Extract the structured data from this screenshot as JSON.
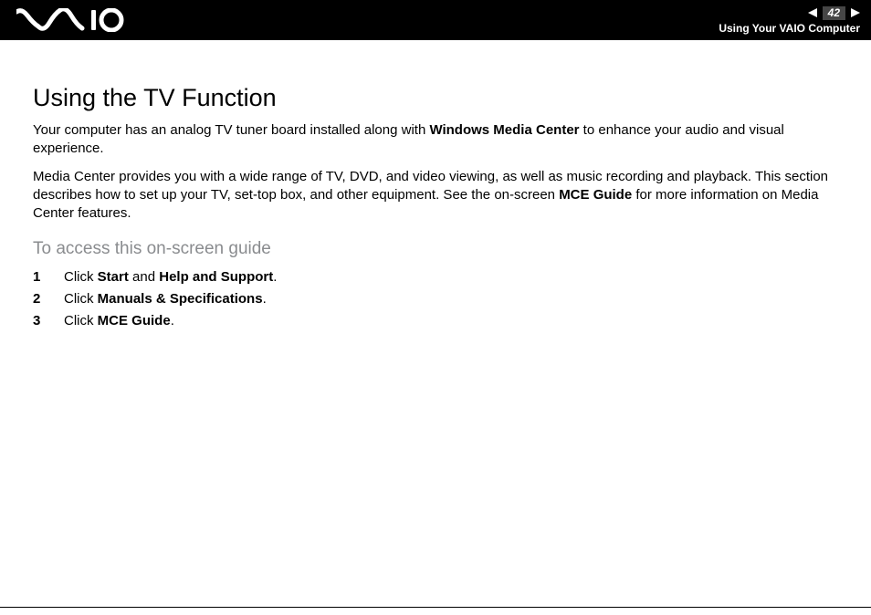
{
  "header": {
    "brand": "VAIO",
    "page_number": "42",
    "section": "Using Your VAIO Computer"
  },
  "main": {
    "title": "Using the TV Function",
    "para1": {
      "pre": "Your computer has an analog TV tuner board installed along with ",
      "bold1": "Windows Media Center",
      "post": " to enhance your audio and visual experience."
    },
    "para2": {
      "pre": "Media Center provides you with a wide range of TV, DVD, and video viewing, as well as music recording and playback. This section describes how to set up your TV, set-top box, and other equipment. See the on-screen ",
      "bold1": "MCE Guide",
      "post": " for more information on Media Center features."
    },
    "subheading": "To access this on-screen guide",
    "steps": [
      {
        "pre": "Click ",
        "b1": "Start",
        "mid": " and ",
        "b2": "Help and Support",
        "post": "."
      },
      {
        "pre": "Click ",
        "b1": "Manuals & Specifications",
        "mid": "",
        "b2": "",
        "post": "."
      },
      {
        "pre": "Click ",
        "b1": "MCE Guide",
        "mid": "",
        "b2": "",
        "post": "."
      }
    ]
  }
}
